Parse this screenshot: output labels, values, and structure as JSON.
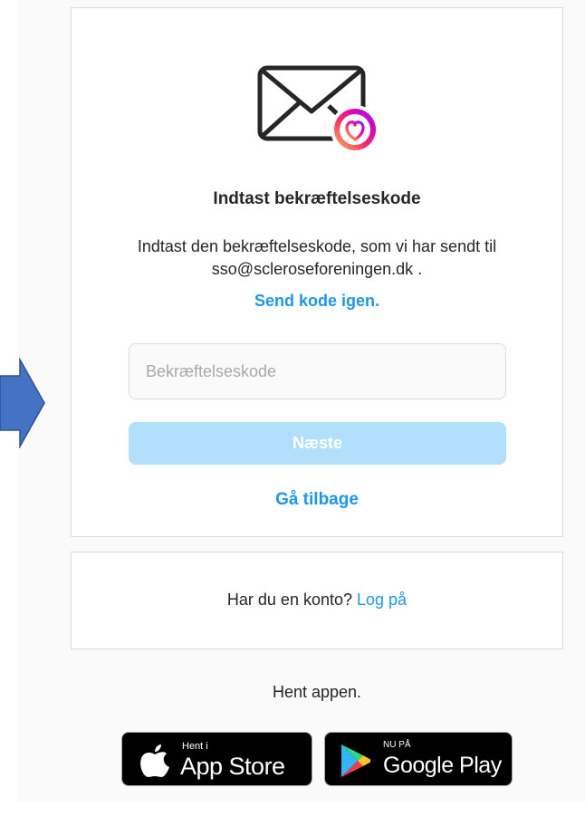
{
  "heading": "Indtast bekræftelseskode",
  "description": "Indtast den bekræftelseskode, som vi har sendt til sso@scleroseforeningen.dk .",
  "resend_link": "Send kode igen.",
  "code_input": {
    "placeholder": "Bekræftelseskode",
    "value": ""
  },
  "next_button": "Næste",
  "back_link": "Gå tilbage",
  "login_card": {
    "prompt": "Har du en konto?",
    "link": "Log på"
  },
  "get_app": "Hent appen.",
  "app_store": {
    "small": "Hent i",
    "big": "App Store"
  },
  "google_play": {
    "small": "NU PÅ",
    "big": "Google Play"
  },
  "colors": {
    "accent": "#1e96ea",
    "button_disabled": "#b2dffc",
    "arrow": "#4472c4"
  },
  "icons": {
    "mail": "envelope-heart-icon",
    "arrow": "right-arrow-icon",
    "apple": "apple-icon",
    "play": "google-play-icon"
  }
}
